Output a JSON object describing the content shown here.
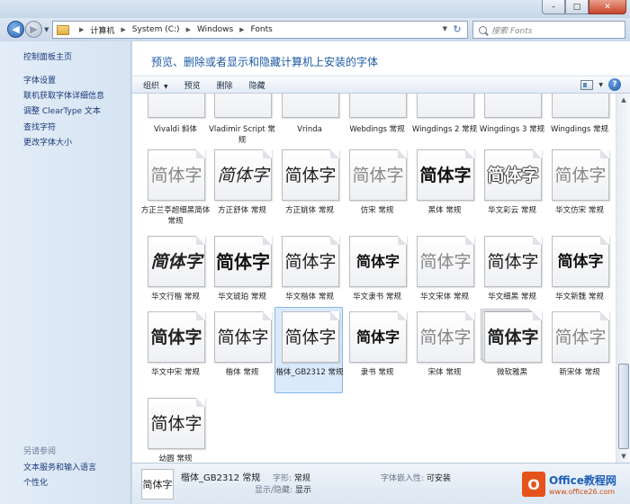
{
  "window": {
    "min_glyph": "–",
    "max_glyph": "□",
    "close_glyph": "✕"
  },
  "address": {
    "crumbs": [
      "计算机",
      "System (C:)",
      "Windows",
      "Fonts"
    ],
    "search_placeholder": "搜索 Fonts"
  },
  "sidebar": {
    "items": [
      "控制面板主页",
      "字体设置",
      "联机获取字体详细信息",
      "调整 ClearType 文本",
      "查找字符",
      "更改字体大小"
    ],
    "see_also_title": "另请参阅",
    "see_also": [
      "文本服务和输入语言",
      "个性化"
    ]
  },
  "main": {
    "heading": "预览、删除或者显示和隐藏计算机上安装的字体"
  },
  "toolbar": {
    "organize": "组织",
    "preview": "预览",
    "delete": "删除",
    "hide": "隐藏"
  },
  "fonts": {
    "row0": [
      "Vivaldi 斜体",
      "Vladimir Script 常规",
      "Vrinda",
      "Webdings 常规",
      "Wingdings 2 常规",
      "Wingdings 3 常规",
      "Wingdings 常规"
    ],
    "sample": "简体字",
    "row1": [
      "方正兰亭超细黑简体 常规",
      "方正舒体 常规",
      "方正姚体 常规",
      "仿宋 常规",
      "黑体 常规",
      "华文彩云 常规",
      "华文仿宋 常规"
    ],
    "row2": [
      "华文行楷 常规",
      "华文琥珀 常规",
      "华文楷体 常规",
      "华文隶书 常规",
      "华文宋体 常规",
      "华文细黑 常规",
      "华文新魏 常规"
    ],
    "row3": [
      "华文中宋 常规",
      "楷体 常规",
      "楷体_GB2312 常规",
      "隶书 常规",
      "宋体 常规",
      "微软雅黑",
      "新宋体 常规"
    ],
    "row4": [
      "幼圆 常规"
    ]
  },
  "status": {
    "name": "楷体_GB2312 常规",
    "style_key": "字形:",
    "style_val": "常规",
    "show_key": "显示/隐藏:",
    "show_val": "显示",
    "embed_key": "字体嵌入性:",
    "embed_val": "可安装",
    "thumb_text": "简体字"
  },
  "watermark": {
    "title": "Office教程网",
    "url": "www.office26.com",
    "logo_letter": "O"
  }
}
